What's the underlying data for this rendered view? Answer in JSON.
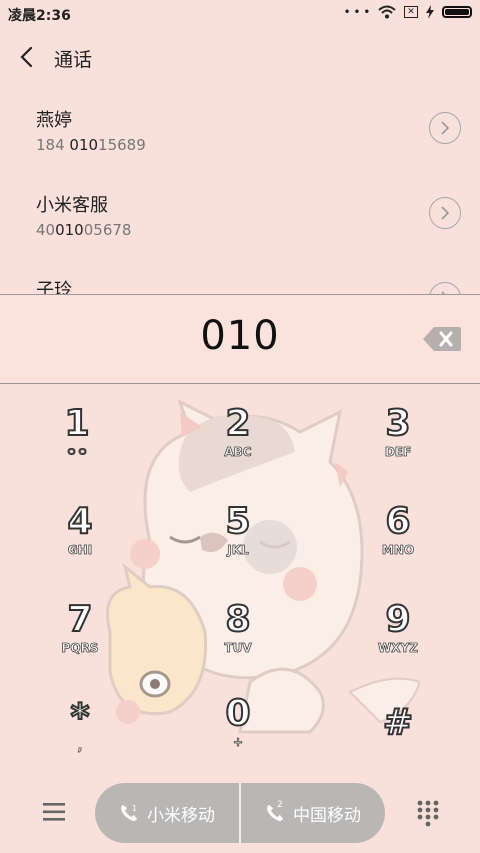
{
  "status_bar": {
    "time": "凌晨2:36",
    "sim_label": "✕"
  },
  "header": {
    "title": "通话"
  },
  "contacts": [
    {
      "name": "燕婷",
      "number_pre": "184 ",
      "number_match": "010",
      "number_post": "15689"
    },
    {
      "name": "小米客服",
      "number_pre": "40",
      "number_match": "010",
      "number_post": "05678"
    },
    {
      "name": "子玲",
      "number_pre": "",
      "number_match": "",
      "number_post": ""
    }
  ],
  "dial_input": {
    "value": "010"
  },
  "keypad": [
    {
      "digit": "1",
      "letters": "ㅇㅇ"
    },
    {
      "digit": "2",
      "letters": "ABC"
    },
    {
      "digit": "3",
      "letters": "DEF"
    },
    {
      "digit": "4",
      "letters": "GHI"
    },
    {
      "digit": "5",
      "letters": "JKL"
    },
    {
      "digit": "6",
      "letters": "MNO"
    },
    {
      "digit": "7",
      "letters": "PQRS"
    },
    {
      "digit": "8",
      "letters": "TUV"
    },
    {
      "digit": "9",
      "letters": "WXYZ"
    },
    {
      "digit": "*",
      "letters": ","
    },
    {
      "digit": "0",
      "letters": "+"
    },
    {
      "digit": "#",
      "letters": ""
    }
  ],
  "bottom_bar": {
    "sim1_label": "小米移动",
    "sim2_label": "中国移动",
    "sim2_index": "2"
  }
}
